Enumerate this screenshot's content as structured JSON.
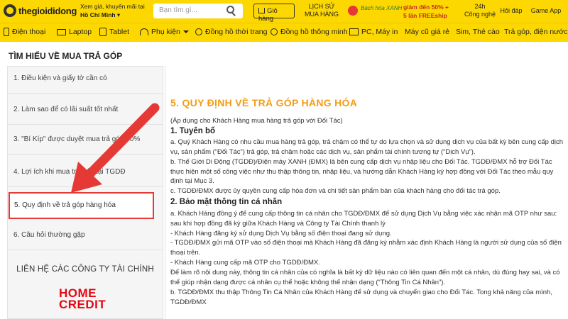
{
  "header": {
    "logo_text": "thegioididong",
    "location_line1": "Xem giá, khuyến mãi tại",
    "location_city": "Hồ Chí Minh ▾",
    "search_placeholder": "Bạn tìm gì...",
    "cart_label": "Giỏ hàng",
    "history_line1": "LỊCH SỬ",
    "history_line2": "MUA HÀNG",
    "promo_brand": "Bách hóa XANH",
    "promo_line1": "giảm đến 50% +",
    "promo_line2": "5 lần FREEship",
    "tech_line1": "24h",
    "tech_line2": "Công nghệ",
    "faq": "Hỏi đáp",
    "game_app": "Game App"
  },
  "nav": {
    "items": [
      {
        "label": "Điện thoại"
      },
      {
        "label": "Laptop"
      },
      {
        "label": "Tablet"
      },
      {
        "label": "Phụ kiện"
      },
      {
        "label": "Đồng hồ thời trang"
      },
      {
        "label": "Đồng hồ thông minh"
      },
      {
        "label": "PC, Máy in"
      },
      {
        "label": "Máy cũ giá rẻ"
      },
      {
        "label": "Sim, Thẻ cào"
      },
      {
        "label": "Trả góp, điện nước"
      }
    ]
  },
  "page": {
    "title": "TÌM HIỂU VỀ MUA TRẢ GÓP"
  },
  "sidebar": {
    "items": [
      {
        "label": "1. Điều kiện và giấy tờ cần có"
      },
      {
        "label": "2. Làm sao để có lãi suất tốt nhất"
      },
      {
        "label": "3. \"Bí Kíp\" được duyệt mua trả góp 90%"
      },
      {
        "label": "4. Lợi ích khi mua trả góp tại TGDĐ"
      },
      {
        "label": "5. Quy định về trả góp hàng hóa"
      },
      {
        "label": "6. Câu hỏi thường gặp"
      }
    ],
    "contact_title": "LIÊN HỆ CÁC CÔNG TY TÀI CHÍNH",
    "partner_logo_line1": "HOME",
    "partner_logo_line2": "CREDIT"
  },
  "content": {
    "section_title": "5. QUY ĐỊNH VỀ TRẢ GÓP HÀNG HÓA",
    "intro": "(Áp dụng cho Khách Hàng mua hàng trả góp với Đối Tác)",
    "heading1": "1. Tuyên bố",
    "p1": "a. Quý Khách Hàng có nhu cầu mua hàng trả góp, trả chậm có thể tự do lựa chọn và sử dụng dịch vụ của bất kỳ bên cung cấp dịch vụ, sản phẩm (“Đối Tác”) trả góp, trả chậm hoặc các dịch vụ, sản phẩm tài chính tương tự (“Dịch Vụ”).",
    "p2": "b. Thế Giới Di Động (TGDĐ)/Điện máy XANH (ĐMX) là bên cung cấp dịch vụ nhập liệu cho Đối Tác. TGDĐ/ĐMX hỗ trợ Đối Tác thực hiện một số công việc như thu thập thông tin, nhập liệu, và hướng dẫn Khách Hàng ký hợp đồng với Đối Tác theo mẫu quy định tại Mục 3.",
    "p3": "c. TGDĐ/ĐMX được ủy quyền cung cấp hóa đơn và chi tiết sản phẩm bán của khách hàng cho đối tác trả góp.",
    "heading2": "2. Bảo mật thông tin cá nhân",
    "p4": "a. Khách Hàng đồng ý để cung cấp thông tin cá nhân cho TGDĐ/ĐMX để sử dụng Dịch Vụ bằng việc xác nhận mã OTP như sau: sau khi hợp đồng đã ký giữa Khách Hàng và Công ty Tài Chính thanh lý",
    "p5": "- Khách Hàng đăng ký sử dụng Dịch Vụ bằng số điện thoại đang sử dụng.",
    "p6": "- TGDĐ/ĐMX gửi mã OTP vào số điện thoại mà Khách Hàng đã đăng ký nhằm xác định Khách Hàng là người sử dụng của số điện thoại trên.",
    "p7": "- Khách Hàng cung cấp mã OTP cho TGDĐ/ĐMX.",
    "p8": "Để làm rõ nội dung này, thông tin cá nhân của có nghĩa là bất kỳ dữ liệu nào có liên quan đến một cá nhân, dù đúng hay sai, và có thể giúp nhận dạng được cá nhân cụ thể hoặc không thể nhận dạng (“Thông Tin Cá Nhân”).",
    "p9": "b. TGDĐ/ĐMX thu thập Thông Tin Cá Nhân của Khách Hàng để sử dụng và chuyển giao cho Đối Tác. Tong khả năng của mình, TGDĐ/ĐMX"
  },
  "colors": {
    "brand_yellow": "#fdd800",
    "section_title": "#f39c12",
    "highlight_red": "#e53935"
  }
}
